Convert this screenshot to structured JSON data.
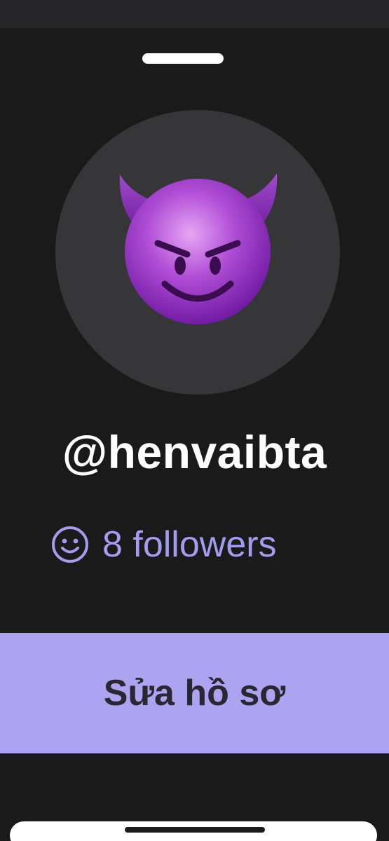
{
  "profile": {
    "avatar_icon": "smiling-face-with-horns-emoji",
    "username": "@henvaibta",
    "followers_icon": "smiley-icon",
    "followers_text": "8 followers"
  },
  "actions": {
    "edit_profile_label": "Sửa hồ sơ"
  },
  "colors": {
    "background": "#1a1a1a",
    "avatar_bg": "#363638",
    "accent": "#a79bf0",
    "button_bg": "#aca3f1",
    "button_text": "#2a2733"
  }
}
